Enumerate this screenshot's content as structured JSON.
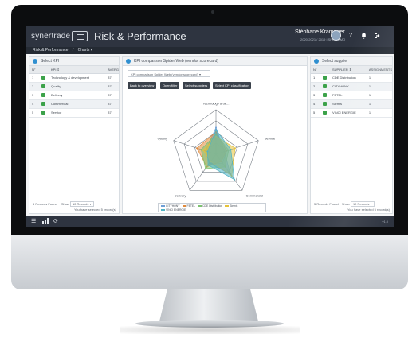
{
  "app": {
    "brand": "synertrade",
    "title": "Risk & Performance"
  },
  "user": {
    "name": "Stéphane Krampner",
    "sub": "2020-2021 / 2019 | SRP-DEMO"
  },
  "topbar_icons": {
    "help": "?",
    "notifications": "bell-icon",
    "logout": "logout-icon"
  },
  "breadcrumb": {
    "root": "Risk & Performance",
    "separator": "/",
    "current": "Charts ▾"
  },
  "kpi_panel": {
    "title": "Select KPI",
    "columns": [
      "N°",
      "",
      "KPI ⇕",
      "AVERG"
    ],
    "rows": [
      {
        "n": "1",
        "name": "Technology & development",
        "avg": "37"
      },
      {
        "n": "2",
        "name": "Quality",
        "avg": "37"
      },
      {
        "n": "3",
        "name": "Delivery",
        "avg": "37"
      },
      {
        "n": "4",
        "name": "Commercial",
        "avg": "37"
      },
      {
        "n": "5",
        "name": "Service",
        "avg": "37"
      }
    ],
    "records": "5 Records Found",
    "show_label": "Show",
    "show_value": "10 Records ▾",
    "selected": "You have selected 5 record(s)"
  },
  "chart_panel": {
    "title": "KPI comparison Spider Web (vendor scorecard)",
    "dropdown": "KPI comparison Spider Web (vendor scorecard)",
    "buttons": [
      "Back to overview",
      "Open filter",
      "Select suppliers",
      "Select KPI classification"
    ]
  },
  "supplier_panel": {
    "title": "Select supplier",
    "columns": [
      "N°",
      "",
      "SUPPLIER ⇕",
      "ASSIGNMENTS"
    ],
    "rows": [
      {
        "n": "1",
        "name": "CDE Distribution",
        "count": "1"
      },
      {
        "n": "2",
        "name": "CITYHONY",
        "count": "1"
      },
      {
        "n": "3",
        "name": "FETEL",
        "count": "1"
      },
      {
        "n": "4",
        "name": "Siemis",
        "count": "1"
      },
      {
        "n": "5",
        "name": "VINCI ENERGIE",
        "count": "1"
      }
    ],
    "records": "5 Records Found",
    "show_label": "Show",
    "show_value": "10 Records ▾",
    "selected": "You have selected 5 record(s)"
  },
  "footer": {
    "version": "v1.0"
  },
  "colors": {
    "accent": "#2f8fd0",
    "brand_orange": "#e0672a",
    "topbar": "#2e3440"
  },
  "chart_data": {
    "type": "radar",
    "axes": [
      "Technology & de...",
      "Service",
      "Commercial",
      "Delivery",
      "Quality"
    ],
    "range": [
      0,
      100
    ],
    "grid_levels": 4,
    "series": [
      {
        "name": "CITYHONY",
        "color": "#6f9fd6",
        "values": [
          60,
          20,
          55,
          25,
          25
        ]
      },
      {
        "name": "FETEL",
        "color": "#e08a3c",
        "values": [
          50,
          25,
          20,
          35,
          45
        ]
      },
      {
        "name": "CDE Distribution",
        "color": "#7cc270",
        "values": [
          45,
          30,
          35,
          40,
          35
        ]
      },
      {
        "name": "Siemis",
        "color": "#e6c23a",
        "values": [
          40,
          45,
          60,
          20,
          30
        ]
      },
      {
        "name": "VINCI ENERGIE",
        "color": "#4fb3c4",
        "values": [
          55,
          35,
          70,
          30,
          20
        ]
      }
    ]
  }
}
